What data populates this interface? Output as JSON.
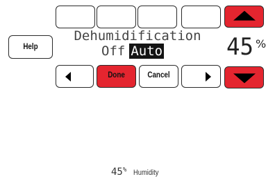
{
  "top_buttons": [
    "",
    "",
    "",
    ""
  ],
  "help_label": "Help",
  "mode": {
    "title": "Dehumidification",
    "options": [
      "Off",
      "Auto"
    ],
    "selected": "Auto"
  },
  "nav": {
    "done_label": "Done",
    "cancel_label": "Cancel"
  },
  "setpoint": {
    "value": "45",
    "unit": "%"
  },
  "status": {
    "value": "45",
    "unit": "%",
    "label": "Humidity"
  },
  "colors": {
    "accent_red": "#e4252f",
    "selected_bg": "#141414"
  },
  "icons": {
    "up": "triangle-up-icon",
    "down": "triangle-down-icon",
    "left": "arrow-left-icon",
    "right": "arrow-right-icon"
  }
}
